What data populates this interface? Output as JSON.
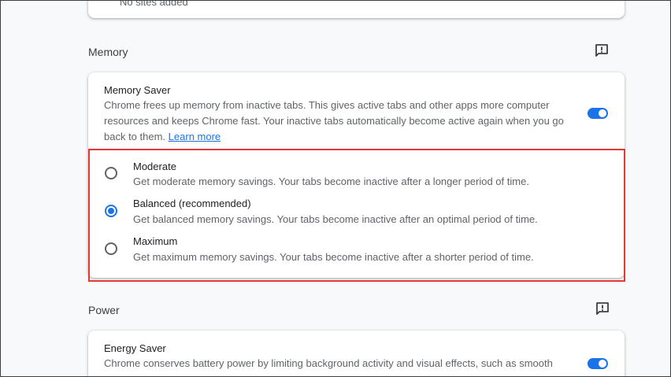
{
  "top_card": {
    "text": "No sites added"
  },
  "memory": {
    "section_title": "Memory",
    "saver": {
      "title": "Memory Saver",
      "desc_line1": "Chrome frees up memory from inactive tabs. This gives active tabs and other apps more computer",
      "desc_line2": "resources and keeps Chrome fast. Your inactive tabs automatically become active again when you go",
      "desc_line3": "back to them.",
      "learn_more": "Learn more",
      "enabled": true
    },
    "options": [
      {
        "label": "Moderate",
        "desc": "Get moderate memory savings. Your tabs become inactive after a longer period of time.",
        "selected": false
      },
      {
        "label": "Balanced (recommended)",
        "desc": "Get balanced memory savings. Your tabs become inactive after an optimal period of time.",
        "selected": true
      },
      {
        "label": "Maximum",
        "desc": "Get maximum memory savings. Your tabs become inactive after a shorter period of time.",
        "selected": false
      }
    ]
  },
  "power": {
    "section_title": "Power",
    "energy_saver": {
      "title": "Energy Saver",
      "desc_line1": "Chrome conserves battery power by limiting background activity and visual effects, such as smooth",
      "enabled": true
    }
  },
  "colors": {
    "accent": "#1a73e8",
    "highlight": "#e53935"
  }
}
